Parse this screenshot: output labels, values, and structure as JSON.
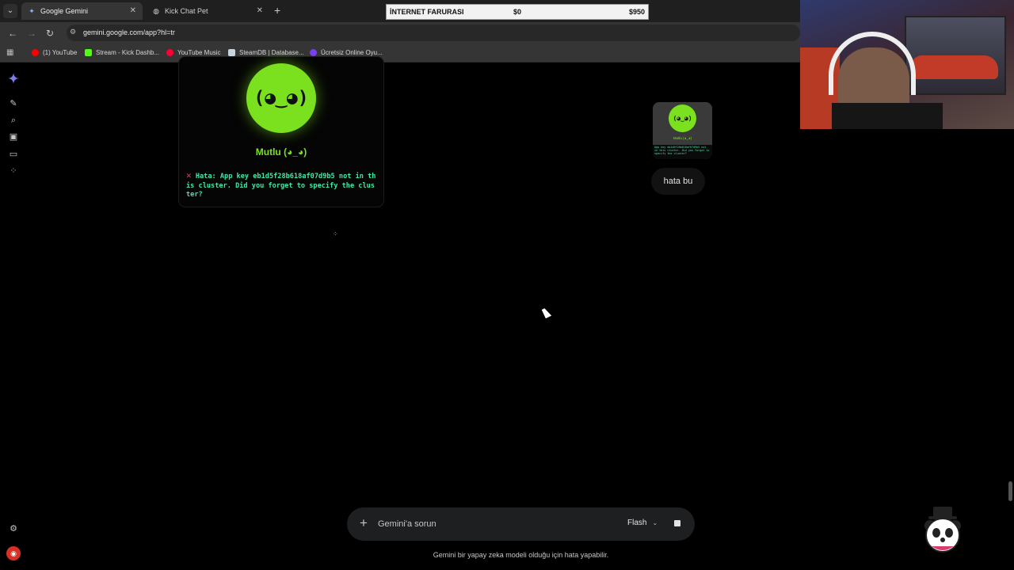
{
  "browser": {
    "tabs": [
      {
        "title": "Google Gemini",
        "active": true
      },
      {
        "title": "Kick Chat Pet",
        "active": false
      }
    ],
    "url": "gemini.google.com/app?hl=tr",
    "bookmarks": [
      {
        "label": "(1) YouTube",
        "color": "#ff0000"
      },
      {
        "label": "Stream - Kick Dashb...",
        "color": "#53fc18"
      },
      {
        "label": "YouTube Music",
        "color": "#ff0033"
      },
      {
        "label": "SteamDB | Database...",
        "color": "#c7d5e0"
      },
      {
        "label": "Ücretsiz Online Oyu...",
        "color": "#7b3ff2"
      }
    ]
  },
  "overlay_bar": {
    "label": "İNTERNET FARURASI",
    "current": "$0",
    "goal": "$950"
  },
  "pet_card": {
    "face": "(◕‿◕)",
    "name": "Mutlu (◕_◕)",
    "error": "Hata: App key eb1d5f28b618af07d9b5 not in this cluster. Did you forget to specify the cluster?"
  },
  "user_message": {
    "text": "hata bu",
    "thumb_face": "(◕‿◕)",
    "thumb_name": "Mutlu (◕_◕)",
    "thumb_error": "App key eb1d5f28b618af07d9b5 not in this cluster. Did you forget to specify the cluster?"
  },
  "prompt": {
    "placeholder": "Gemini'a sorun",
    "model": "Flash"
  },
  "disclaimer": "Gemini bir yapay zeka modeli olduğu için hata yapabilir.",
  "colors": {
    "pet_green": "#7be01e",
    "error_text": "#3ee8a6",
    "error_x": "#e23c5a"
  }
}
